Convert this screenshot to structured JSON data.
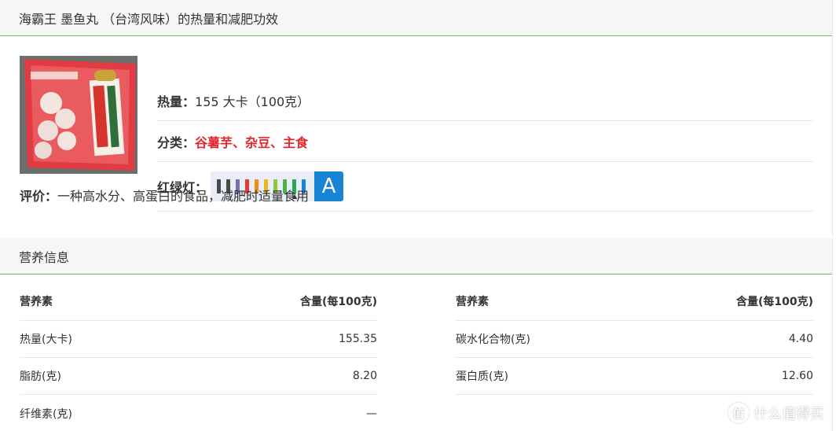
{
  "food": {
    "title": "海霸王 墨鱼丸 （台湾风味）的热量和减肥功效",
    "calories_label": "热量：",
    "calories_value": "155 大卡（100克）",
    "category_label": "分类：",
    "category_value": "谷薯芋、杂豆、主食",
    "light_label": "红绿灯：",
    "light_grade": "A",
    "light_colors": [
      "#4a4a4a",
      "#4a4a4a",
      "#7a6fa8",
      "#e53935",
      "#f08a1c",
      "#f3b01b",
      "#8dc63f",
      "#4caf50",
      "#2ba55a",
      "#1a84d4"
    ],
    "comment_label": "评价：",
    "comment_value": "一种高水分、高蛋白的食品，减肥时适量食用"
  },
  "nutrition": {
    "title": "营养信息",
    "header_nutrient": "营养素",
    "header_amount": "含量(每100克)",
    "left": [
      {
        "name": "热量(大卡)",
        "value": "155.35"
      },
      {
        "name": "脂肪(克)",
        "value": "8.20"
      },
      {
        "name": "纤维素(克)",
        "value": "—"
      }
    ],
    "right": [
      {
        "name": "碳水化合物(克)",
        "value": "4.40"
      },
      {
        "name": "蛋白质(克)",
        "value": "12.60"
      }
    ]
  },
  "watermark": {
    "icon_char": "值",
    "text": "什么值得买"
  }
}
